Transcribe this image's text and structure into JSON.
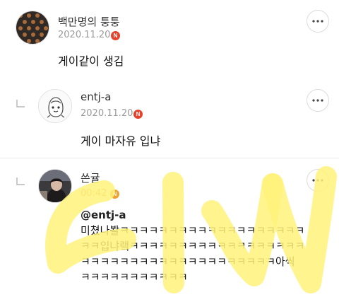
{
  "comments": [
    {
      "author": "백만명의 퉁퉁",
      "date": "2020.11.20",
      "badge": "N",
      "text": "게이같이 생김",
      "avatar_icon": "pattern-avatar-icon"
    },
    {
      "author": "entj-a",
      "date": "2020.11.20",
      "badge": "N",
      "text": "게이 마자유 입냐",
      "avatar_icon": "character-avatar-icon"
    },
    {
      "author": "쓴귤",
      "date": "00:42",
      "badge": "N",
      "mention": "@entj-a",
      "lines": [
        "미쳤나봘ㅋㅋㅋㅋㅋㅋㅋㅋㅋㅋㅋㅋㅋㅋㅋㅋㅋㅋㅋ",
        "ㅋㅋ입냐랰ㅋㅋㅋㅋㅋㅋㅋㅋㅋㅋㅋㅋㅋㅋㅋㅋㅋㅋ",
        "ㅋㅋㅋㅋㅋㅋㅋㅋㅋㅋㅋㅋㅋㅋㅋㅋㅋㅋㅋㅋ아씩",
        "ㅋㅋㅋㅋㅋㅋㅋㅋㅋㅋㅋ"
      ],
      "avatar_icon": "photo-avatar-icon"
    }
  ],
  "overlay_text": "ㄷㅣㅆ",
  "colors": {
    "badge": "#e8412c",
    "recent_time": "#f0a030",
    "highlight": "#fff27a"
  }
}
